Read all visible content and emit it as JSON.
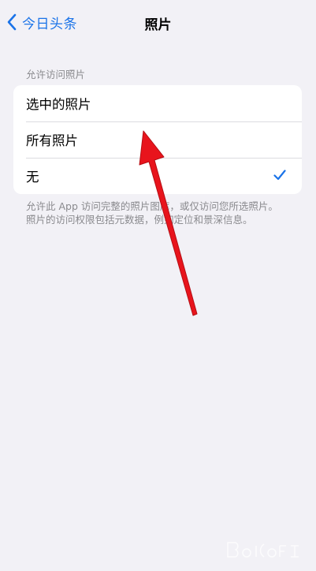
{
  "nav": {
    "back_label": "今日头条",
    "title": "照片"
  },
  "section": {
    "header": "允许访问照片",
    "options": [
      {
        "label": "选中的照片",
        "selected": false
      },
      {
        "label": "所有照片",
        "selected": false
      },
      {
        "label": "无",
        "selected": true
      }
    ],
    "footer": "允许此 App 访问完整的照片图库，或仅访问您所选照片。照片的访问权限包括元数据，例如定位和景深信息。"
  },
  "colors": {
    "accent": "#1A73E8",
    "background": "#F2F1F6",
    "annotation_arrow": "#E8141C"
  },
  "icons": {
    "back": "chevron-left-icon",
    "selected": "checkmark-icon"
  }
}
